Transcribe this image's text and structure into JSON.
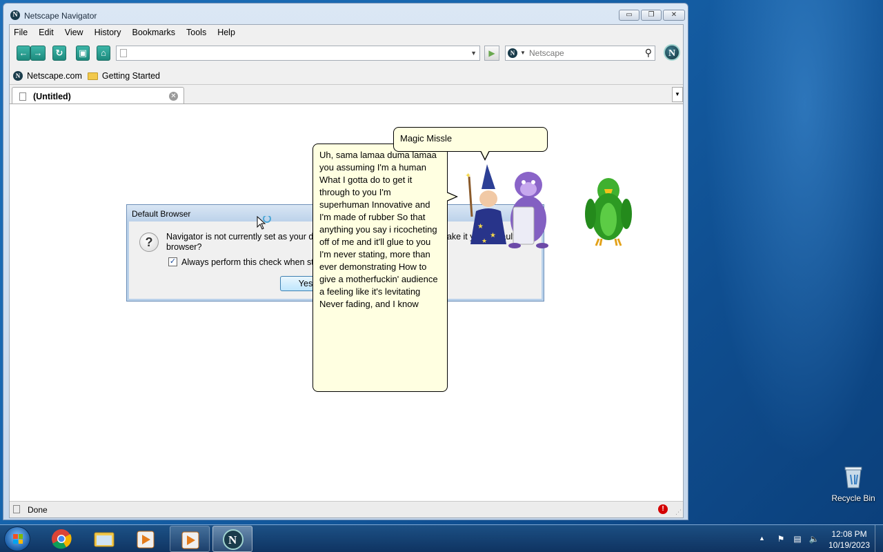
{
  "window": {
    "title": "Netscape Navigator",
    "controls": {
      "minimize": "▭",
      "restore": "❐",
      "close": "✕"
    }
  },
  "menu": [
    "File",
    "Edit",
    "View",
    "History",
    "Bookmarks",
    "Tools",
    "Help"
  ],
  "toolbar": {
    "url_value": "",
    "search_placeholder": "Netscape"
  },
  "bookmarks": [
    {
      "label": "Netscape.com",
      "icon": "netscape-icon"
    },
    {
      "label": "Getting Started",
      "icon": "folder-icon"
    }
  ],
  "tabs": [
    {
      "label": "(Untitled)"
    }
  ],
  "status": {
    "text": "Done"
  },
  "dialog": {
    "title": "Default Browser",
    "message": "Navigator is not currently set as your default browser. Would you like to make it your default browser?",
    "checkbox_label": "Always perform this check when starting Navigator.",
    "checkbox_checked": true,
    "yes_label": "Yes"
  },
  "bubbles": {
    "small": "Magic Missle",
    "large": "Uh, sama lamaa duma lamaa you assuming I'm a human What I gotta do to get it through to you I'm superhuman Innovative and I'm made of rubber So that anything you say i ricocheting off of me and it'll glue to you I'm never stating, more than ever demonstrating How to give a motherfuckin' audience a feeling like it's levitating Never fading, and I know"
  },
  "taskbar": {
    "time": "12:08 PM",
    "date": "10/19/2023",
    "apps": [
      "chrome-icon",
      "explorer-icon",
      "media-player-icon",
      "media-player-icon",
      "netscape-icon"
    ]
  },
  "desktop": {
    "recycle_bin_label": "Recycle Bin"
  },
  "colors": {
    "bubble_bg": "#ffffe1",
    "desktop_blue": "#1765ad",
    "netscape_teal": "#1d8a7d"
  }
}
